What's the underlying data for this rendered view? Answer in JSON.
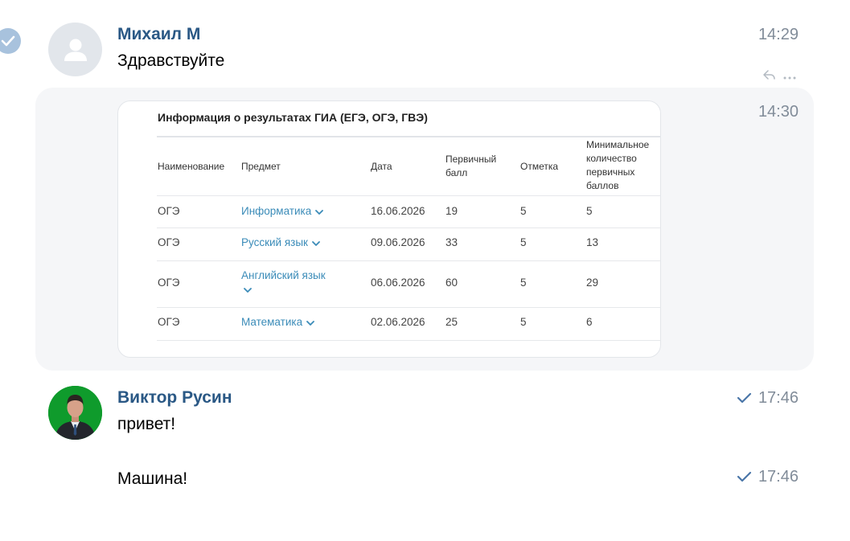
{
  "messages": [
    {
      "author": "Михаил М",
      "text": "Здравствуйте",
      "time": "14:29"
    },
    {
      "time": "14:30",
      "attachment": {
        "title": "Информация о результатах ГИА (ЕГЭ, ОГЭ, ГВЭ)",
        "columns": {
          "name": "Наименование",
          "subject": "Предмет",
          "date": "Дата",
          "primary_score_line1": "Первичный",
          "primary_score_line2": "балл",
          "grade": "Отметка",
          "min_line1": "Минимальное",
          "min_line2": "количество",
          "min_line3": "первичных",
          "min_line4": "баллов"
        },
        "rows": [
          {
            "name": "ОГЭ",
            "subject": "Информатика",
            "date": "16.06.2026",
            "score": "19",
            "grade": "5",
            "min": "5"
          },
          {
            "name": "ОГЭ",
            "subject": "Русский язык",
            "date": "09.06.2026",
            "score": "33",
            "grade": "5",
            "min": "13"
          },
          {
            "name": "ОГЭ",
            "subject": "Английский язык",
            "date": "06.06.2026",
            "score": "60",
            "grade": "5",
            "min": "29"
          },
          {
            "name": "ОГЭ",
            "subject": "Математика",
            "date": "02.06.2026",
            "score": "25",
            "grade": "5",
            "min": "6"
          }
        ]
      }
    },
    {
      "author": "Виктор Русин",
      "text": "привет!",
      "time": "17:46"
    },
    {
      "text": "Машина!",
      "time": "17:46"
    }
  ],
  "icons": {
    "selected": "check-circle-icon",
    "avatar_placeholder": "user-silhouette-icon",
    "reply": "reply-icon",
    "more": "more-dots-icon",
    "read": "checkmark-icon",
    "expand": "chevron-down-icon"
  },
  "colors": {
    "author": "#2a5885",
    "time": "#818c99",
    "link": "#3a8bb8",
    "highlight": "#f5f6f8",
    "selected_check": "#a8c2dd",
    "read_check": "#4a76a8"
  }
}
